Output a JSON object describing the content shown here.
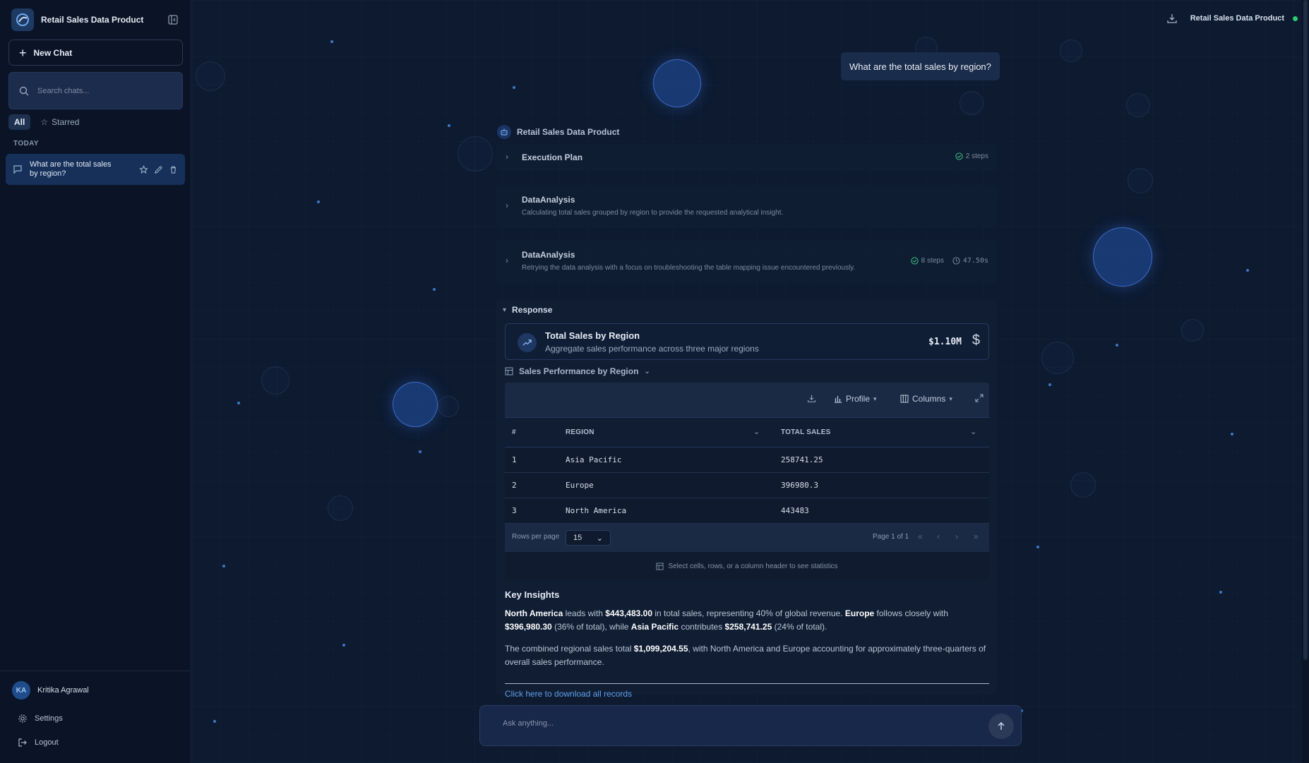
{
  "app": {
    "title": "Retail Sales Data Product"
  },
  "sidebar": {
    "new_chat_label": "New Chat",
    "search_placeholder": "Search chats...",
    "filters": [
      "All",
      "Starred"
    ],
    "section_label": "TODAY",
    "chats": [
      {
        "title": "What are the total sales by region?"
      }
    ],
    "user": {
      "initials": "KA",
      "name": "Kritika Agrawal"
    },
    "settings_label": "Settings",
    "logout_label": "Logout"
  },
  "topbar": {
    "product_name": "Retail Sales Data Product",
    "status_color": "#2ecc71"
  },
  "conversation": {
    "user_question": "What are the total sales by region?",
    "agent_name": "Retail Sales Data Product",
    "steps": [
      {
        "title": "Execution Plan",
        "description": "",
        "steps_count": "2 steps",
        "duration": ""
      },
      {
        "title": "DataAnalysis",
        "description": "Calculating total sales grouped by region to provide the requested analytical insight.",
        "steps_count": "",
        "duration": ""
      },
      {
        "title": "DataAnalysis",
        "description": "Retrying the data analysis with a focus on troubleshooting the table mapping issue encountered previously.",
        "steps_count": "8 steps",
        "duration": "47.50s"
      }
    ],
    "response": {
      "label": "Response",
      "kpi": {
        "title": "Total Sales by Region",
        "subtitle": "Aggregate sales performance across three major regions",
        "value": "$1.10M",
        "currency_symbol": "$"
      },
      "table": {
        "title": "Sales Performance by Region",
        "toolbar": {
          "profile_label": "Profile",
          "columns_label": "Columns"
        },
        "columns": [
          "#",
          "REGION",
          "TOTAL SALES"
        ],
        "rows": [
          [
            "1",
            "Asia Pacific",
            "258741.25"
          ],
          [
            "2",
            "Europe",
            "396980.3"
          ],
          [
            "3",
            "North America",
            "443483"
          ]
        ],
        "rows_per_page_label": "Rows per page",
        "rows_per_page_value": "15",
        "page_info": "Page 1 of 1",
        "stats_hint": "Select cells, rows, or a column header to see statistics"
      },
      "insights": {
        "heading": "Key Insights",
        "p1": {
          "r1": "North America",
          "t1": " leads with ",
          "r2": "$443,483.00",
          "t2": " in total sales, representing 40% of global revenue. ",
          "r3": "Europe",
          "t3": " follows closely with ",
          "r4": "$396,980.30",
          "t4": " (36% of total), while ",
          "r5": "Asia Pacific",
          "t5": " contributes ",
          "r6": "$258,741.25",
          "t6": " (24% of total)."
        },
        "p2": {
          "t1": "The combined regional sales total ",
          "r1": "$1,099,204.55",
          "t2": ", with North America and Europe accounting for approximately three-quarters of overall sales performance."
        }
      },
      "download_link": "Click here to download all records"
    }
  },
  "composer": {
    "placeholder": "Ask anything..."
  },
  "icons": {
    "logo": "logo-icon",
    "collapse": "sidebar-collapse-icon",
    "search": "search-icon",
    "chat": "chat-bubble-icon",
    "star": "star-icon",
    "edit": "pencil-icon",
    "delete": "trash-icon",
    "settings": "gear-icon",
    "logout": "logout-icon",
    "download": "download-icon",
    "bot": "bot-icon",
    "trend": "trend-up-icon",
    "send": "arrow-up-icon"
  }
}
